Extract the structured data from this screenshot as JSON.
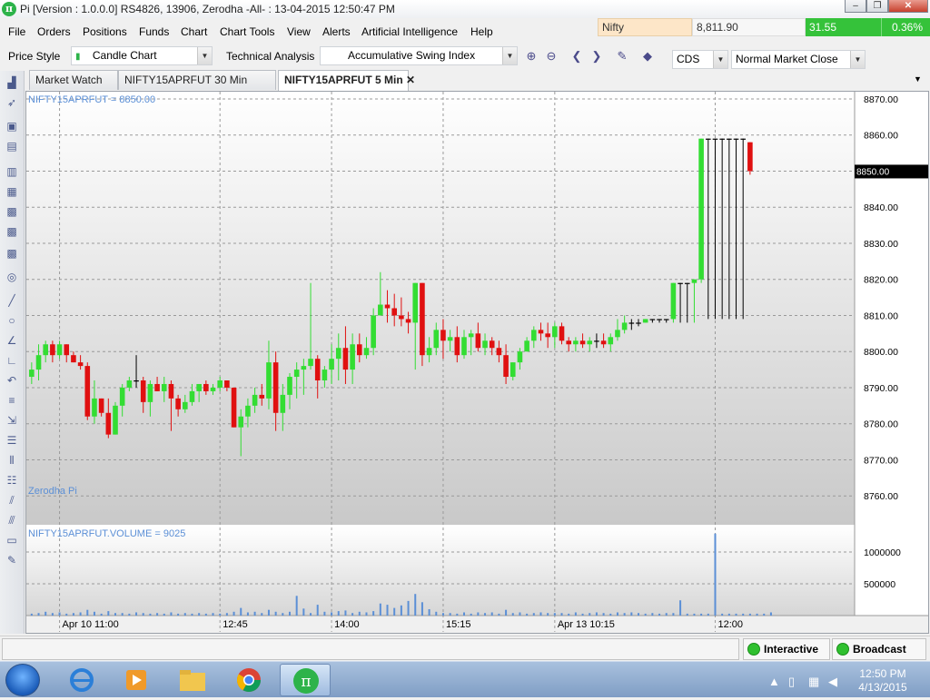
{
  "window": {
    "title": "Pi [Version : 1.0.0.0] RS4826, 13906, Zerodha -All- : 13-04-2015 12:50:47 PM",
    "app_icon": "π"
  },
  "quote": {
    "symbol": "Nifty",
    "price": "8,811.90",
    "change": "31.55",
    "change_pct": "0.36%"
  },
  "menu": [
    "File",
    "Orders",
    "Positions",
    "Funds",
    "Chart",
    "Chart Tools",
    "View",
    "Alerts",
    "Artificial Intelligence",
    "Help"
  ],
  "toolbar": {
    "price_style_label": "Price Style",
    "price_style_value": "Candle Chart",
    "ta_label": "Technical Analysis",
    "ta_value": "Accumulative Swing Index",
    "exchange_value": "CDS",
    "market_value": "Normal Market Close"
  },
  "tabs": [
    {
      "label": "Market Watch"
    },
    {
      "label": "NIFTY15APRFUT 30 Min"
    },
    {
      "label": "NIFTY15APRFUT 5 Min"
    }
  ],
  "chart_data": {
    "type": "candlestick",
    "price_label": "NIFTY15APRFUT = 8850.00",
    "watermark": "Zerodha Pi",
    "volume_label": "NIFTY15APRFUT.VOLUME = 9025",
    "last_price_tag": "8850.00",
    "ylim": [
      8752,
      8872
    ],
    "yticks": [
      "8870.00",
      "8860.00",
      "8850.00",
      "8840.00",
      "8830.00",
      "8820.00",
      "8810.00",
      "8800.00",
      "8790.00",
      "8780.00",
      "8770.00",
      "8760.00"
    ],
    "volume_ticks": [
      "1000000",
      "500000"
    ],
    "volume_ylim": [
      0,
      1400000
    ],
    "x_ticks": [
      "Apr 10 11:00",
      "12:45",
      "14:00",
      "15:15",
      "Apr 13 10:15",
      "12:00"
    ],
    "colors": {
      "up": "#33dd33",
      "down": "#e01010",
      "volume": "#5b8fd6",
      "doji": "#000000"
    },
    "candles": [
      [
        8793,
        8797,
        8791,
        8795
      ],
      [
        8795,
        8802,
        8792,
        8799
      ],
      [
        8799,
        8803,
        8797,
        8802
      ],
      [
        8802,
        8803,
        8797,
        8799
      ],
      [
        8799,
        8803,
        8798,
        8802
      ],
      [
        8802,
        8802,
        8797,
        8799
      ],
      [
        8799,
        8800,
        8797,
        8797
      ],
      [
        8797,
        8799,
        8795,
        8796
      ],
      [
        8796,
        8797,
        8781,
        8782
      ],
      [
        8782,
        8792,
        8780,
        8787
      ],
      [
        8787,
        8787,
        8782,
        8783
      ],
      [
        8783,
        8787,
        8776,
        8777
      ],
      [
        8777,
        8786,
        8777,
        8785
      ],
      [
        8785,
        8791,
        8782,
        8790
      ],
      [
        8790,
        8793,
        8789,
        8792
      ],
      [
        8792,
        8799,
        8790,
        8792
      ],
      [
        8792,
        8793,
        8783,
        8786
      ],
      [
        8786,
        8792,
        8782,
        8791
      ],
      [
        8791,
        8793,
        8789,
        8789
      ],
      [
        8789,
        8793,
        8786,
        8791
      ],
      [
        8791,
        8792,
        8778,
        8787
      ],
      [
        8787,
        8788,
        8782,
        8784
      ],
      [
        8784,
        8788,
        8783,
        8786
      ],
      [
        8786,
        8791,
        8785,
        8789
      ],
      [
        8789,
        8791,
        8786,
        8791
      ],
      [
        8791,
        8792,
        8788,
        8789
      ],
      [
        8789,
        8791,
        8788,
        8790
      ],
      [
        8790,
        8793,
        8789,
        8792
      ],
      [
        8792,
        8792,
        8789,
        8790
      ],
      [
        8790,
        8790,
        8779,
        8779
      ],
      [
        8779,
        8784,
        8771,
        8782
      ],
      [
        8782,
        8787,
        8779,
        8785
      ],
      [
        8785,
        8790,
        8783,
        8788
      ],
      [
        8788,
        8791,
        8785,
        8787
      ],
      [
        8787,
        8803,
        8784,
        8797
      ],
      [
        8797,
        8800,
        8778,
        8783
      ],
      [
        8783,
        8791,
        8778,
        8788
      ],
      [
        8788,
        8794,
        8784,
        8793
      ],
      [
        8793,
        8797,
        8787,
        8795
      ],
      [
        8795,
        8798,
        8788,
        8796
      ],
      [
        8796,
        8819,
        8795,
        8798
      ],
      [
        8798,
        8799,
        8787,
        8792
      ],
      [
        8792,
        8796,
        8790,
        8795
      ],
      [
        8795,
        8802,
        8791,
        8798
      ],
      [
        8798,
        8805,
        8792,
        8801
      ],
      [
        8801,
        8807,
        8791,
        8795
      ],
      [
        8795,
        8805,
        8791,
        8802
      ],
      [
        8802,
        8805,
        8797,
        8799
      ],
      [
        8799,
        8804,
        8798,
        8801
      ],
      [
        8801,
        8812,
        8799,
        8810
      ],
      [
        8810,
        8822,
        8811,
        8813
      ],
      [
        8813,
        8817,
        8808,
        8812
      ],
      [
        8812,
        8816,
        8807,
        8810
      ],
      [
        8810,
        8815,
        8807,
        8809
      ],
      [
        8809,
        8811,
        8805,
        8808
      ],
      [
        8808,
        8819,
        8795,
        8819
      ],
      [
        8819,
        8819,
        8796,
        8799
      ],
      [
        8799,
        8804,
        8797,
        8801
      ],
      [
        8801,
        8808,
        8799,
        8806
      ],
      [
        8806,
        8809,
        8798,
        8803
      ],
      [
        8803,
        8806,
        8800,
        8804
      ],
      [
        8804,
        8807,
        8797,
        8799
      ],
      [
        8799,
        8806,
        8798,
        8804
      ],
      [
        8804,
        8806,
        8799,
        8805
      ],
      [
        8805,
        8808,
        8800,
        8801
      ],
      [
        8801,
        8805,
        8799,
        8803
      ],
      [
        8803,
        8804,
        8799,
        8801
      ],
      [
        8801,
        8803,
        8797,
        8799
      ],
      [
        8799,
        8802,
        8791,
        8793
      ],
      [
        8793,
        8797,
        8792,
        8797
      ],
      [
        8797,
        8801,
        8795,
        8800
      ],
      [
        8800,
        8804,
        8800,
        8803
      ],
      [
        8803,
        8807,
        8801,
        8806
      ],
      [
        8806,
        8808,
        8803,
        8805
      ],
      [
        8805,
        8808,
        8801,
        8804
      ],
      [
        8804,
        8808,
        8801,
        8807
      ],
      [
        8807,
        8808,
        8802,
        8803
      ],
      [
        8803,
        8804,
        8800,
        8802
      ],
      [
        8802,
        8804,
        8800,
        8803
      ],
      [
        8803,
        8805,
        8801,
        8802
      ],
      [
        8802,
        8804,
        8800,
        8803
      ],
      [
        8803,
        8805,
        8801,
        8803
      ],
      [
        8803,
        8805,
        8801,
        8802
      ],
      [
        8802,
        8805,
        8800,
        8804
      ],
      [
        8804,
        8809,
        8803,
        8806
      ],
      [
        8806,
        8810,
        8805,
        8808
      ],
      [
        8808,
        8809,
        8806,
        8808
      ],
      [
        8808,
        8809,
        8807,
        8808
      ],
      [
        8808,
        8809,
        8808,
        8809
      ],
      [
        8809,
        8809,
        8808,
        8809
      ],
      [
        8809,
        8809,
        8808,
        8809
      ],
      [
        8809,
        8809,
        8808,
        8809
      ],
      [
        8809,
        8819,
        8808,
        8819
      ],
      [
        8819,
        8819,
        8808,
        8819
      ],
      [
        8819,
        8819,
        8808,
        8819
      ],
      [
        8819,
        8820,
        8808,
        8820
      ],
      [
        8820,
        8859,
        8819,
        8859
      ],
      [
        8859,
        8859,
        8809,
        8859
      ],
      [
        8859,
        8859,
        8809,
        8859
      ],
      [
        8859,
        8859,
        8809,
        8859
      ],
      [
        8859,
        8859,
        8809,
        8859
      ],
      [
        8859,
        8859,
        8809,
        8859
      ],
      [
        8859,
        8859,
        8809,
        8859
      ],
      [
        8858,
        8858,
        8849,
        8850
      ]
    ],
    "volume": [
      30000,
      40000,
      60000,
      40000,
      50000,
      30000,
      40000,
      50000,
      90000,
      60000,
      30000,
      70000,
      40000,
      40000,
      30000,
      50000,
      40000,
      30000,
      40000,
      30000,
      50000,
      30000,
      40000,
      30000,
      40000,
      30000,
      40000,
      30000,
      40000,
      60000,
      120000,
      50000,
      60000,
      40000,
      90000,
      60000,
      40000,
      60000,
      310000,
      110000,
      40000,
      170000,
      60000,
      50000,
      70000,
      80000,
      40000,
      60000,
      50000,
      70000,
      190000,
      170000,
      120000,
      160000,
      230000,
      340000,
      210000,
      100000,
      60000,
      40000,
      40000,
      30000,
      50000,
      30000,
      50000,
      40000,
      50000,
      30000,
      90000,
      40000,
      50000,
      30000,
      40000,
      50000,
      40000,
      40000,
      40000,
      30000,
      50000,
      30000,
      40000,
      50000,
      40000,
      30000,
      50000,
      40000,
      50000,
      40000,
      30000,
      40000,
      30000,
      40000,
      40000,
      240000,
      30000,
      30000,
      30000,
      30000,
      1290000,
      30000,
      30000,
      30000,
      30000,
      30000,
      30000,
      30000,
      50000
    ]
  },
  "status": {
    "interactive": "Interactive",
    "broadcast": "Broadcast"
  },
  "taskbar": {
    "time": "12:50 PM",
    "date": "4/13/2015"
  }
}
